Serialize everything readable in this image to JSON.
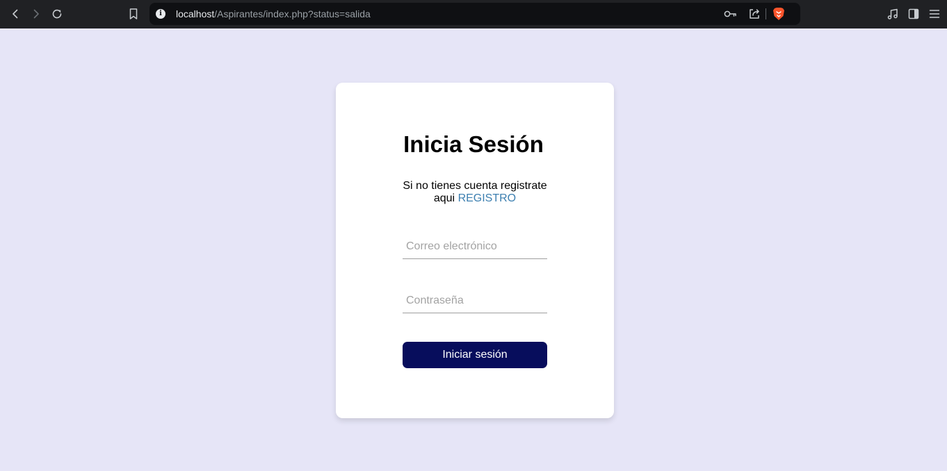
{
  "browser": {
    "url_host": "localhost",
    "url_path": "/Aspirantes/index.php?status=salida",
    "icons": {
      "back": "back-arrow-icon",
      "forward": "forward-arrow-icon",
      "reload": "reload-icon",
      "bookmark": "bookmark-icon",
      "site_info": "info-icon",
      "password_key": "key-icon",
      "share": "share-icon",
      "brave_shield": "brave-lion-icon",
      "media": "music-note-icon",
      "sidebar": "sidebar-icon",
      "menu": "hamburger-menu-icon"
    },
    "site_info_glyph": "i"
  },
  "page": {
    "background_color": "#e6e5f7",
    "accent_color": "#070d5c",
    "link_color": "#3c7fb0"
  },
  "login": {
    "title": "Inicia Sesión",
    "prompt_text": "Si no tienes cuenta registrate aqui",
    "register_link": "REGISTRO",
    "email_placeholder": "Correo electrónico",
    "email_value": "",
    "password_placeholder": "Contraseña",
    "password_value": "",
    "submit_label": "Iniciar sesión"
  }
}
